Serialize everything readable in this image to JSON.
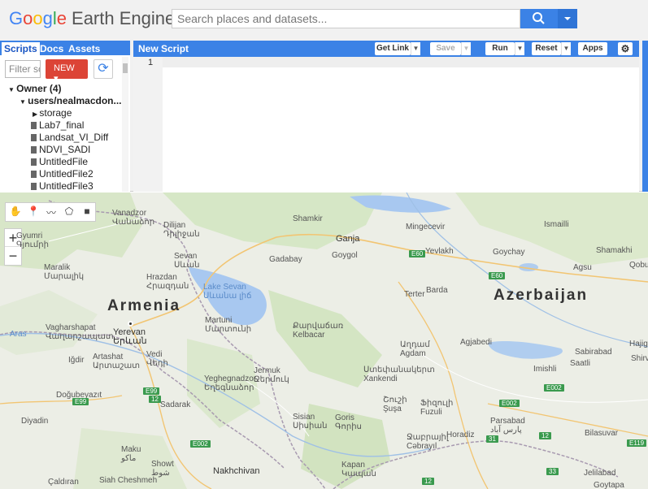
{
  "header": {
    "logo_google": "Google",
    "logo_product": "Earth Engine",
    "search_placeholder": "Search places and datasets..."
  },
  "left_panel": {
    "tabs": [
      "Scripts",
      "Docs",
      "Assets"
    ],
    "filter_placeholder": "Filter sc",
    "new_button": "NEW ▾",
    "tree": {
      "owner": "Owner  (4)",
      "user": "users/nealmacdon...",
      "folder": "storage",
      "files": [
        "Lab7_final",
        "Landsat_VI_Diff",
        "NDVI_SADI",
        "UntitledFile",
        "UntitledFile2",
        "UntitledFile3"
      ]
    }
  },
  "editor": {
    "title": "New Script",
    "buttons": {
      "get_link": "Get Link",
      "save": "Save",
      "run": "Run",
      "reset": "Reset",
      "apps": "Apps"
    },
    "line_number": "1"
  },
  "map": {
    "labels": {
      "armenia": "Armenia",
      "azerbaijan": "Azerbaijan",
      "yerevan": "Yerevan",
      "yerevan_arm": "Երևան",
      "ganja": "Ganja",
      "lake_sevan": "Lake Sevan",
      "lake_sevan_arm": "Սևանա լիճ",
      "mingecevir": "Mingecevir",
      "yevlakh": "Yevlakh",
      "barda": "Barda",
      "gyumri": "Gyumri",
      "gyumri_arm": "Գյումրի",
      "vanadzor": "Vanadzor",
      "vanadzor_arm": "Վանաձոր",
      "dilijan": "Dilijan",
      "dilijan_arm": "Դիլիջան",
      "sevan": "Sevan",
      "sevan_arm": "Սևան",
      "hrazdan": "Hrazdan",
      "hrazdan_arm": "Հրազդան",
      "martuni": "Martuni",
      "martuni_arm": "Մարտունի",
      "vagharshapat": "Vagharshapat",
      "vagharshapat_arm": "Վաղարշապատ",
      "maralik": "Maralik",
      "maralik_arm": "Մարալիկ",
      "kelbacar": "Kelbacar",
      "kelbacar_arm": "Քարվաճառ",
      "gadabay": "Gadabay",
      "goygol": "Goygol",
      "terter": "Terter",
      "agdam": "Agdam",
      "agdam_arm": "Աղդամ",
      "xankendi": "Xankendi",
      "xankendi_arm": "Ստեփանակերտ",
      "shamkir": "Shamkir",
      "ismailli": "Ismailli",
      "goychay": "Goychay",
      "agsu": "Agsu",
      "shamakhi": "Shamakhi",
      "qobu": "Qobu",
      "agjabedi": "Agjabedi",
      "imishli": "Imishli",
      "saatli": "Saatli",
      "sabirabad": "Sabirabad",
      "hajiga": "Hajiga",
      "shirv": "Shirv",
      "igdir": "Iğdir",
      "artashat": "Artashat",
      "artashat_arm": "Արտաշատ",
      "vedi": "Vedi",
      "vedi_arm": "Վեդի",
      "yeghegnadzor": "Yeghegnadzor",
      "yeghegnadzor_arm": "Եղեգնաձոր",
      "jermuk": "Jermuk",
      "jermuk_arm": "Ջերմուկ",
      "sadarak": "Sadarak",
      "diyadin": "Diyadin",
      "dogubeyazit": "Doğubeyazıt",
      "sisian": "Sisian",
      "sisian_arm": "Սիսիան",
      "goris": "Goris",
      "goris_arm": "Գորիս",
      "shusha": "Şuşa",
      "shusha_arm": "Շուշի",
      "fuzuli": "Fuzuli",
      "fuzuli_arm": "Ֆիզուլի",
      "cebrayil": "Cəbrayıl",
      "cebrayil_arm": "Ջաբրայիլ",
      "horadiz": "Horadiz",
      "bilasuvar": "Bilasuvar",
      "parsabad": "Parsabad",
      "parsabad_fa": "پارس آباد",
      "maku": "Maku",
      "maku_fa": "ماکو",
      "showt": "Showt",
      "showt_fa": "شوط",
      "siah_cheshmeh": "Siah Cheshmeh",
      "caldiran": "Çaldıran",
      "nakhchivan": "Nakhchivan",
      "kapan": "Kapan",
      "kapan_arm": "Կապան",
      "jelilabad": "Jelilabad",
      "goytapa": "Goytapa",
      "aras": "Aras"
    },
    "shields": [
      "E60",
      "E60",
      "E99",
      "E99",
      "12",
      "E002",
      "E002",
      "E002",
      "E119",
      "31",
      "33",
      "12",
      "12"
    ]
  },
  "colors": {
    "accent": "#3b82e6",
    "new_button": "#dc4436"
  }
}
